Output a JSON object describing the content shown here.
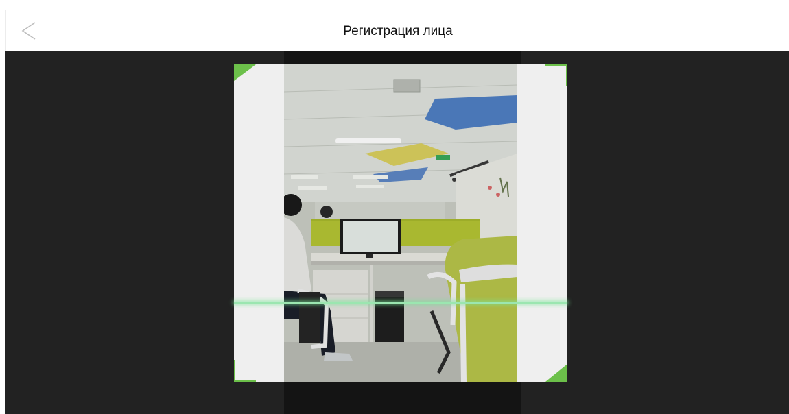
{
  "header": {
    "title": "Регистрация лица",
    "back_icon": "chevron-left-icon"
  },
  "capture": {
    "frame_accent_color": "#6cc04a",
    "scan_line_color": "#9be6b0"
  }
}
